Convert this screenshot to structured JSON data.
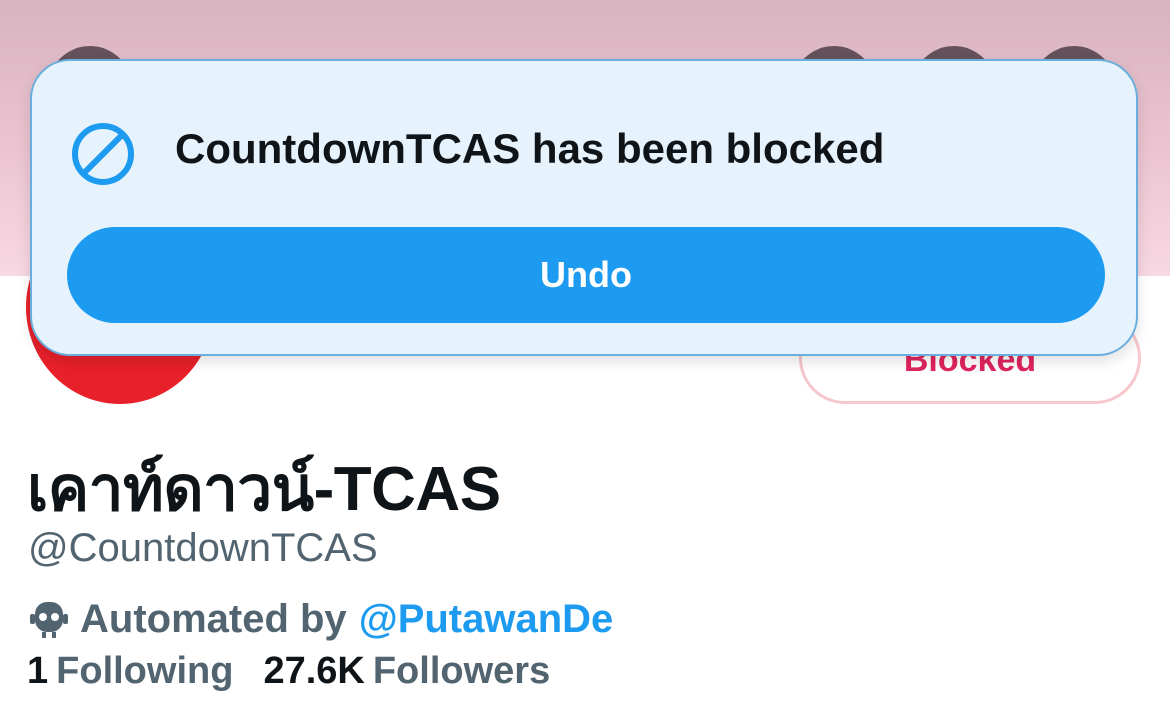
{
  "profile": {
    "display_name": "เคาท์ดาวน์-TCAS",
    "handle": "@CountdownTCAS",
    "automated_prefix": "Automated by",
    "automated_by": "@PutawanDe",
    "following_count": "1",
    "following_label": "Following",
    "followers_count": "27.6K",
    "followers_label": "Followers",
    "blocked_button_label": "Blocked",
    "avatar_color": "#e8202a",
    "banner_color": "#e9c3cf"
  },
  "toast": {
    "message": "CountdownTCAS has been blocked",
    "undo_label": "Undo",
    "icon": "block-icon",
    "accent_color": "#1d9bf0"
  },
  "icons": {
    "automated": "robot-icon"
  }
}
